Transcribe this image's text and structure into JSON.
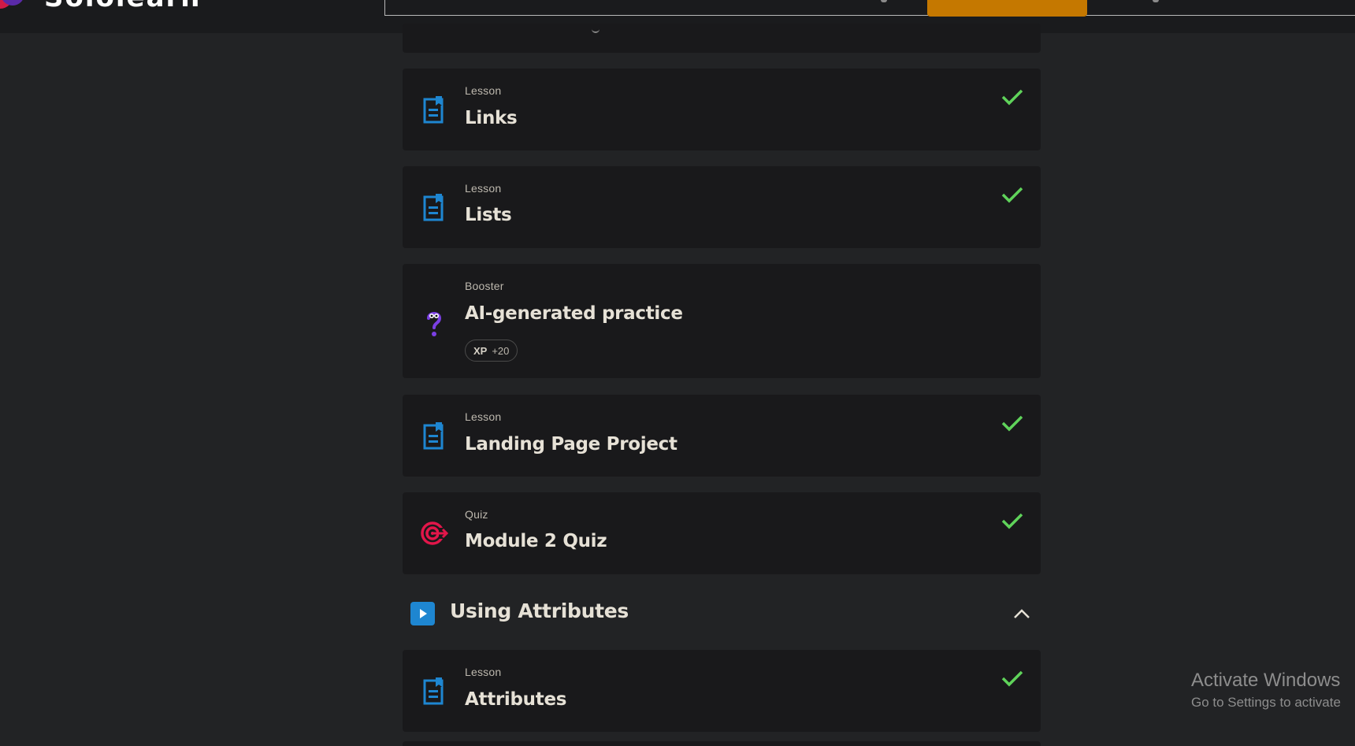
{
  "app": {
    "logo_text": "Sololearn"
  },
  "header": {
    "cta_label": ""
  },
  "items": [
    {
      "type": "Lesson",
      "title": "Links",
      "icon": "lesson-icon",
      "completed": true
    },
    {
      "type": "Lesson",
      "title": "Lists",
      "icon": "lesson-icon",
      "completed": true
    },
    {
      "type": "Booster",
      "title": "AI-generated practice",
      "icon": "booster-icon",
      "completed": false,
      "xp_label": "XP",
      "xp_value": "+20"
    },
    {
      "type": "Lesson",
      "title": "Landing Page Project",
      "icon": "lesson-icon",
      "completed": true
    },
    {
      "type": "Quiz",
      "title": "Module 2 Quiz",
      "icon": "quiz-target-icon",
      "completed": true
    }
  ],
  "module": {
    "title": "Using Attributes",
    "icon": "play-icon",
    "expanded": true
  },
  "module_items": [
    {
      "type": "Lesson",
      "title": "Attributes",
      "icon": "lesson-icon",
      "completed": true
    }
  ],
  "watermark": {
    "title": "Activate Windows",
    "subtitle": "Go to Settings to activate"
  },
  "colors": {
    "background": "#222325",
    "card": "#19191b",
    "accent_blue": "#1e86d1",
    "check_green": "#5fd35a",
    "cta_orange": "#c57800",
    "quiz_red": "#e2164a",
    "booster_purple": "#7b3fe4"
  }
}
